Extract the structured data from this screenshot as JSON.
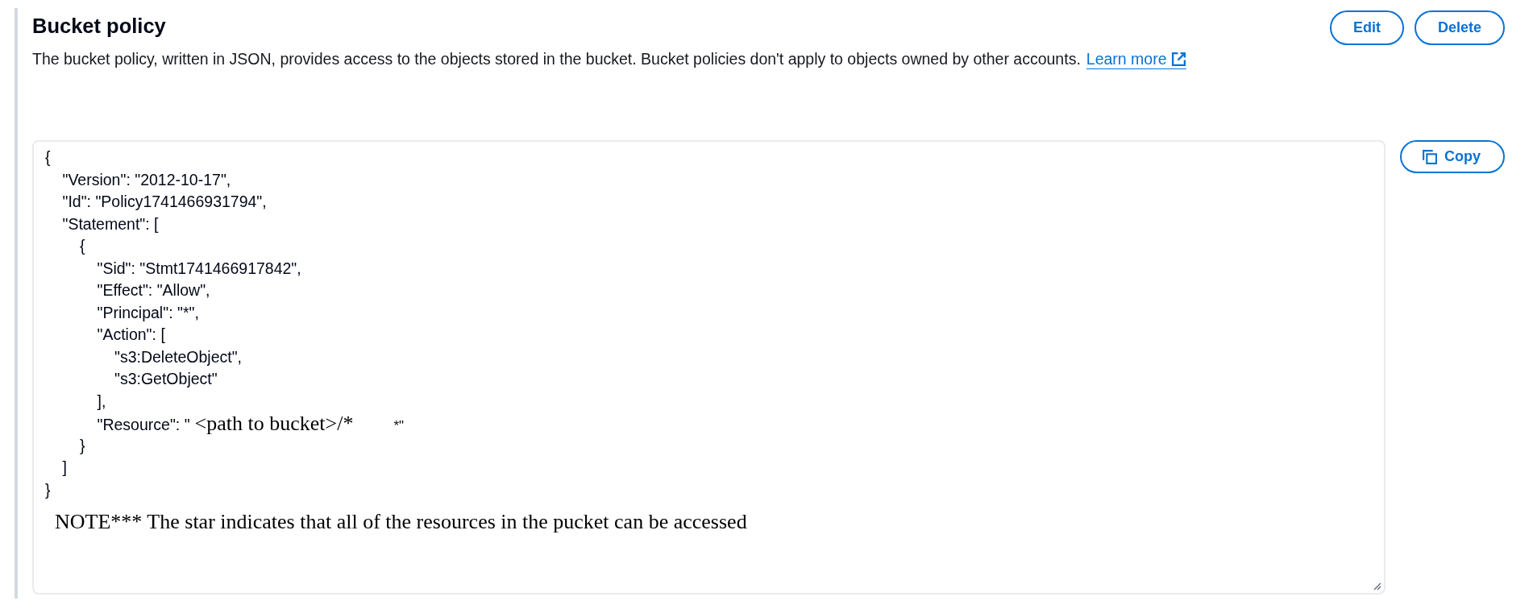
{
  "section": {
    "title": "Bucket policy",
    "description": "The bucket policy, written in JSON, provides access to the objects stored in the bucket. Bucket policies don't apply to objects owned by other accounts.",
    "link": "Learn more"
  },
  "buttons": [
    "Edit",
    "Delete"
  ],
  "policy": {
    "lines": [
      {
        "kind": "code",
        "text": "{",
        "children": [
          {
            "kind": "code",
            "text": "\"Version\": \"2012-10-17\","
          },
          {
            "kind": "code",
            "text": "\"Id\": \"Policy1741466931794\","
          },
          {
            "kind": "code",
            "text": "\"Statement\": [",
            "children": [
              {
                "kind": "code",
                "text": "{",
                "children": [
                  {
                    "kind": "code",
                    "text": "\"Sid\": \"Stmt1741466917842\","
                  },
                  {
                    "kind": "code",
                    "text": "\"Effect\": \"Allow\","
                  },
                  {
                    "kind": "code",
                    "text": "\"Principal\": \"*\","
                  },
                  {
                    "kind": "code",
                    "text": "\"Action\": [",
                    "children": [
                      {
                        "kind": "code",
                        "text": "\"s3:DeleteObject\","
                      },
                      {
                        "kind": "code",
                        "text": "\"s3:GetObject\""
                      }
                    ]
                  },
                  {
                    "kind": "code",
                    "text": "],"
                  },
                  {
                    "kind": "edited",
                    "text": "\"Resource\": \"",
                    "overlay": "<path to bucket>/*",
                    "tail": "*\""
                  }
                ]
              },
              {
                "kind": "code",
                "text": "}"
              }
            ]
          },
          {
            "kind": "code",
            "text": "]"
          }
        ]
      },
      {
        "kind": "code",
        "text": "}"
      }
    ],
    "note": "NOTE*** The star indicates that all of the resources in the pucket can be accessed"
  },
  "copy_button": {
    "label": "Copy"
  }
}
